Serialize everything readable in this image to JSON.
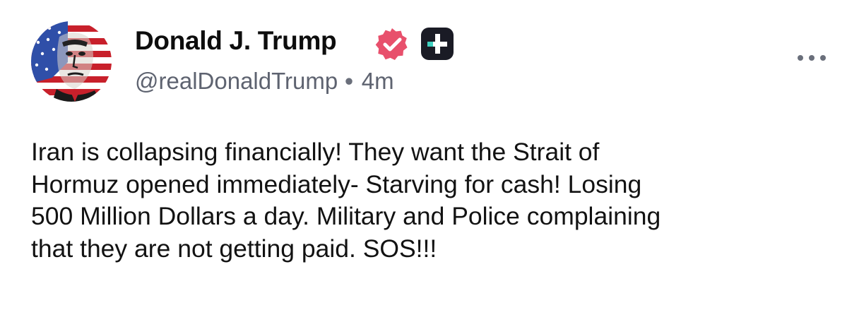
{
  "post": {
    "author": {
      "display_name": "Donald J. Trump",
      "handle": "@realDonaldTrump",
      "avatar_icon": "flag-portrait-avatar",
      "verified_icon": "verified-badge-icon",
      "badge_icon": "plus-badge-icon"
    },
    "separator": "•",
    "timestamp": "4m",
    "more_icon": "more-options-icon",
    "body_lines": [
      "Iran is collapsing financially! They want the Strait of",
      "Hormuz opened immediately- Starving for cash! Losing",
      "500 Million Dollars a day. Military and Police complaining",
      "that they are not getting paid. SOS!!!"
    ]
  },
  "colors": {
    "verified_badge": "#e8506c",
    "plus_badge": "#1a1b25",
    "meta_text": "#5e6370",
    "body_text": "#121212"
  }
}
